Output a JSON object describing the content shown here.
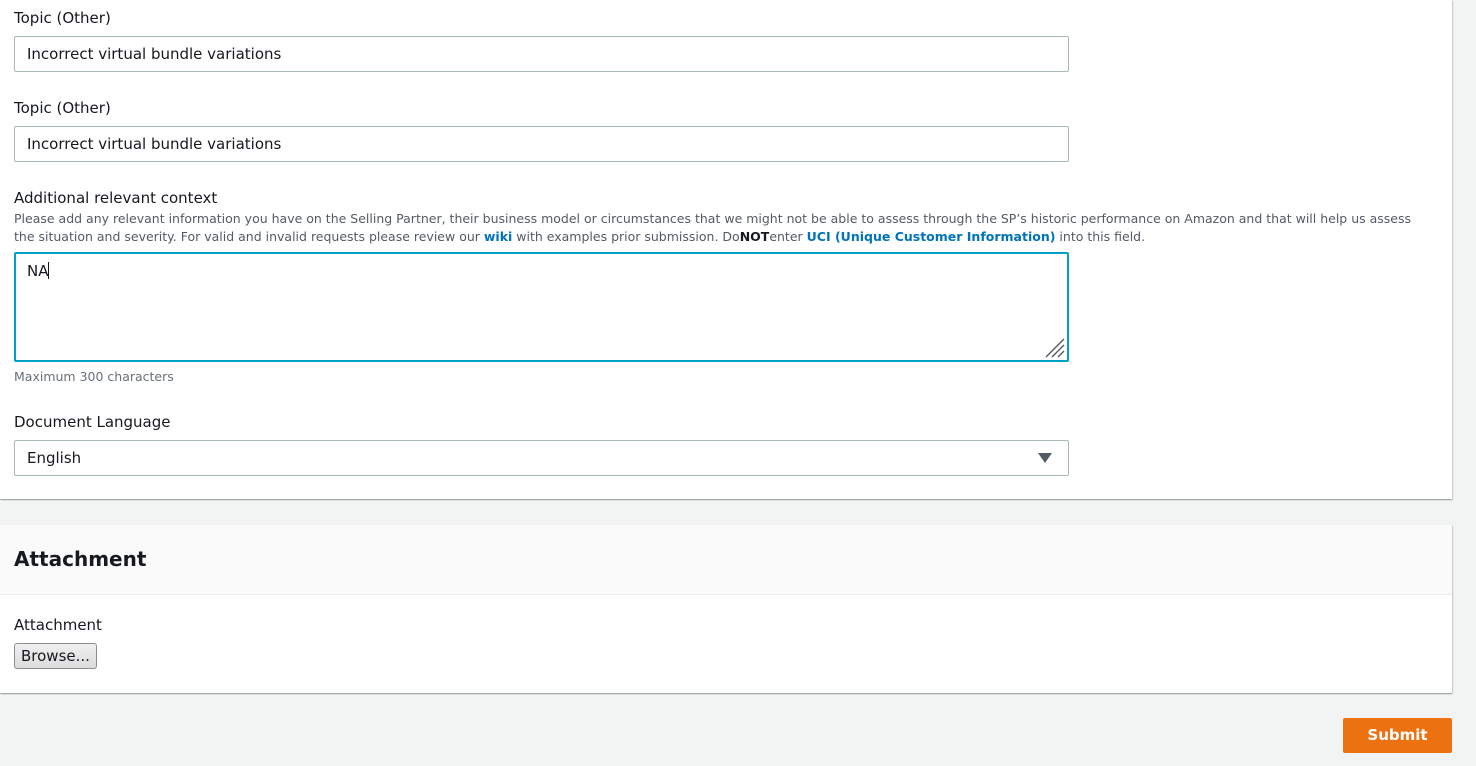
{
  "form": {
    "topic_other_1": {
      "label": "Topic (Other)",
      "value": "Incorrect virtual bundle variations"
    },
    "topic_other_2": {
      "label": "Topic (Other)",
      "value": "Incorrect virtual bundle variations"
    },
    "context": {
      "label": "Additional relevant context",
      "description_part1": "Please add any relevant information you have on the Selling Partner, their business model or circumstances that we might not be able to assess through the SP’s historic performance on Amazon and that will help us assess the situation and severity. For valid and invalid requests please review our ",
      "wiki_link": "wiki",
      "description_part2": " with examples prior submission. Do",
      "not_text": "NOT",
      "description_part3": "enter ",
      "uci_link": "UCI (Unique Customer Information)",
      "description_part4": " into this field.",
      "value": "NA",
      "hint": "Maximum 300 characters"
    },
    "document_language": {
      "label": "Document Language",
      "selected": "English"
    }
  },
  "attachment": {
    "section_title": "Attachment",
    "field_label": "Attachment",
    "browse_label": "Browse..."
  },
  "actions": {
    "submit_label": "Submit"
  },
  "colors": {
    "accent": "#ec7211",
    "link": "#0073bb",
    "focus": "#00a1c9"
  }
}
